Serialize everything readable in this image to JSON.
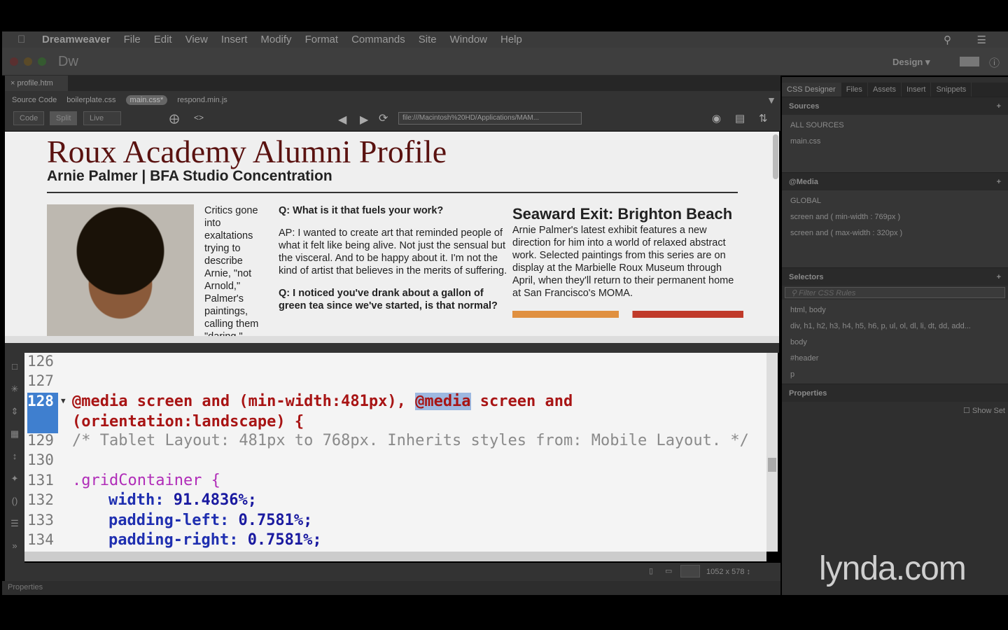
{
  "menubar": {
    "app": "Dreamweaver",
    "items": [
      "File",
      "Edit",
      "View",
      "Insert",
      "Modify",
      "Format",
      "Commands",
      "Site",
      "Window",
      "Help"
    ]
  },
  "titlebar": {
    "logo": "Dw",
    "workspace": "Design ▾"
  },
  "document": {
    "tab": "profile.htm",
    "related": [
      "Source Code",
      "boilerplate.css",
      "main.css*",
      "respond.min.js"
    ],
    "views": [
      "Code",
      "Split",
      "Live"
    ],
    "url": "file:///Macintosh%20HD/Applications/MAM..."
  },
  "page": {
    "title": "Roux Academy Alumni Profile",
    "subtitle": "Arnie Palmer | BFA Studio Concentration",
    "critics": "Critics gone into exaltations trying to describe Arnie, \"not Arnold,\" Palmer's paintings, calling them \"daring.\"",
    "q1": "Q: What is it that fuels your work?",
    "a1": "AP: I wanted to create art that reminded people of what it felt like being alive. Not just the sensual but the visceral. And to be happy about it. I'm not the kind of artist that believes in the merits of suffering.",
    "q2": "Q: I noticed you've drank about a gallon of green tea since we've started, is that normal?",
    "article_title": "Seaward Exit: Brighton Beach",
    "article_body": "Arnie Palmer's latest exhibit features a new direction for him into a world of relaxed abstract work. Selected paintings from this series are on display at the Marbielle Roux Museum through April, when they'll return to their permanent home at San Francisco's MOMA."
  },
  "code": {
    "lines": [
      {
        "n": "126"
      },
      {
        "n": "127"
      },
      {
        "n": "128",
        "a": "@media screen and (min-width:481px), ",
        "b": "@media",
        "c": " screen and",
        "d": "(orientation:landscape) {"
      },
      {
        "n": "129",
        "t": "/* Tablet Layout: 481px to 768px. Inherits styles from: Mobile Layout. */"
      },
      {
        "n": "130"
      },
      {
        "n": "131",
        "t": ".gridContainer {"
      },
      {
        "n": "132",
        "p": "width",
        "v": "91.4836%;"
      },
      {
        "n": "133",
        "p": "padding-left",
        "v": "0.7581%;"
      },
      {
        "n": "134",
        "p": "padding-right",
        "v": "0.7581%;"
      }
    ]
  },
  "status": {
    "size": "1052 x 578 ↕"
  },
  "properties_label": "Properties",
  "panel": {
    "tabs": [
      "CSS Designer",
      "Files",
      "Assets",
      "Insert",
      "Snippets"
    ],
    "sources_h": "Sources",
    "sources": [
      "ALL SOURCES",
      "main.css"
    ],
    "media_h": "@Media",
    "media": [
      "GLOBAL",
      "screen and ( min-width : 769px )",
      "screen and ( max-width : 320px )"
    ],
    "selectors_h": "Selectors",
    "filter_placeholder": "Filter CSS Rules",
    "selectors": [
      "html, body",
      "div, h1, h2, h3, h4, h5, h6, p, ul, ol, dl, li, dt, dd, add...",
      "body",
      "#header",
      "p"
    ],
    "properties_h": "Properties",
    "show_set": "Show Set"
  },
  "watermark": "lynda.com"
}
